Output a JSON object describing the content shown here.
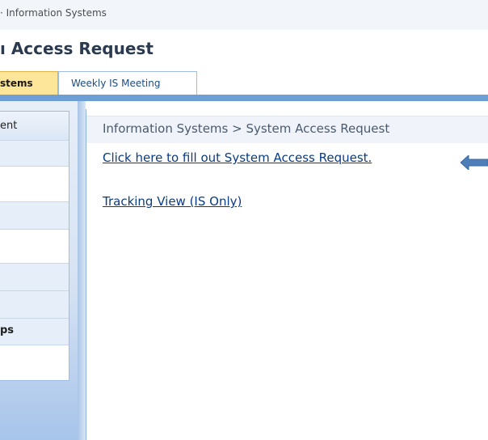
{
  "site": {
    "breadcrumb_fragment": "· Information Systems",
    "page_title": "ı Access Request"
  },
  "tabs": [
    {
      "label": "stems",
      "active": true
    },
    {
      "label": "Weekly IS Meeting",
      "active": false
    }
  ],
  "left_nav": {
    "header": "ent",
    "group_label": "ps"
  },
  "content": {
    "breadcrumb": "Information Systems > System Access Request",
    "links": {
      "fill_out": "Click here to fill out System Access Request.",
      "tracking": "Tracking View (IS Only)"
    }
  },
  "colors": {
    "accent": "#6e9ed6",
    "active_tab": "#fde59a",
    "link": "#0b3b82",
    "arrow": "#4f7fb8"
  },
  "icons": {
    "pointer_arrow": "left-arrow-icon"
  }
}
